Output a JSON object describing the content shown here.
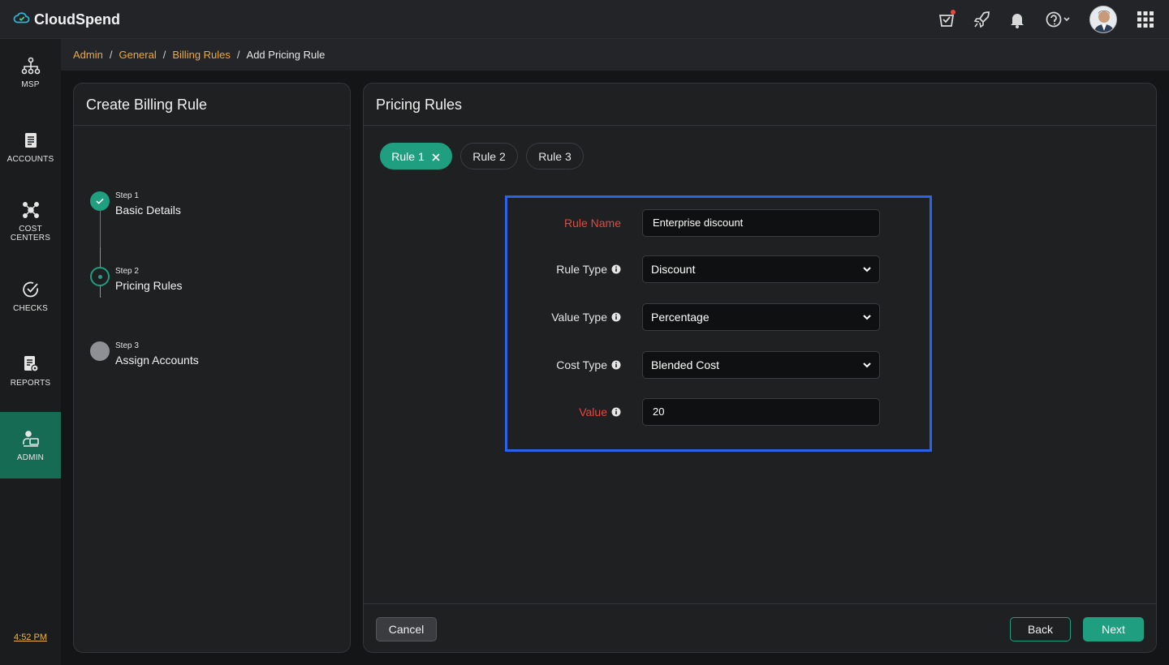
{
  "app": {
    "name": "CloudSpend"
  },
  "sidebar": {
    "items": [
      {
        "label": "MSP",
        "icon": "org-chart-icon"
      },
      {
        "label": "ACCOUNTS",
        "icon": "document-icon"
      },
      {
        "label": "COST CENTERS",
        "icon": "network-icon"
      },
      {
        "label": "CHECKS",
        "icon": "check-circle-icon"
      },
      {
        "label": "REPORTS",
        "icon": "report-icon"
      },
      {
        "label": "ADMIN",
        "icon": "admin-icon",
        "active": true
      }
    ],
    "clock": "4:52 PM"
  },
  "breadcrumb": {
    "items": [
      "Admin",
      "General",
      "Billing Rules"
    ],
    "current": "Add Pricing Rule"
  },
  "left_panel": {
    "title": "Create Billing Rule",
    "steps": [
      {
        "small": "Step 1",
        "label": "Basic Details",
        "state": "done"
      },
      {
        "small": "Step 2",
        "label": "Pricing Rules",
        "state": "current"
      },
      {
        "small": "Step 3",
        "label": "Assign Accounts",
        "state": "todo"
      }
    ]
  },
  "right_panel": {
    "title": "Pricing Rules",
    "tabs": [
      {
        "label": "Rule 1",
        "active": true
      },
      {
        "label": "Rule 2",
        "active": false
      },
      {
        "label": "Rule 3",
        "active": false
      }
    ],
    "form": {
      "rule_name": {
        "label": "Rule Name",
        "value": "Enterprise discount"
      },
      "rule_type": {
        "label": "Rule Type",
        "value": "Discount"
      },
      "value_type": {
        "label": "Value Type",
        "value": "Percentage"
      },
      "cost_type": {
        "label": "Cost Type",
        "value": "Blended Cost"
      },
      "value": {
        "label": "Value",
        "value": "20"
      }
    },
    "footer": {
      "cancel": "Cancel",
      "back": "Back",
      "next": "Next"
    }
  },
  "colors": {
    "accent": "#1f9e80",
    "link": "#f0a93a",
    "required": "#e8473f",
    "highlight_border": "#2b63e8"
  }
}
